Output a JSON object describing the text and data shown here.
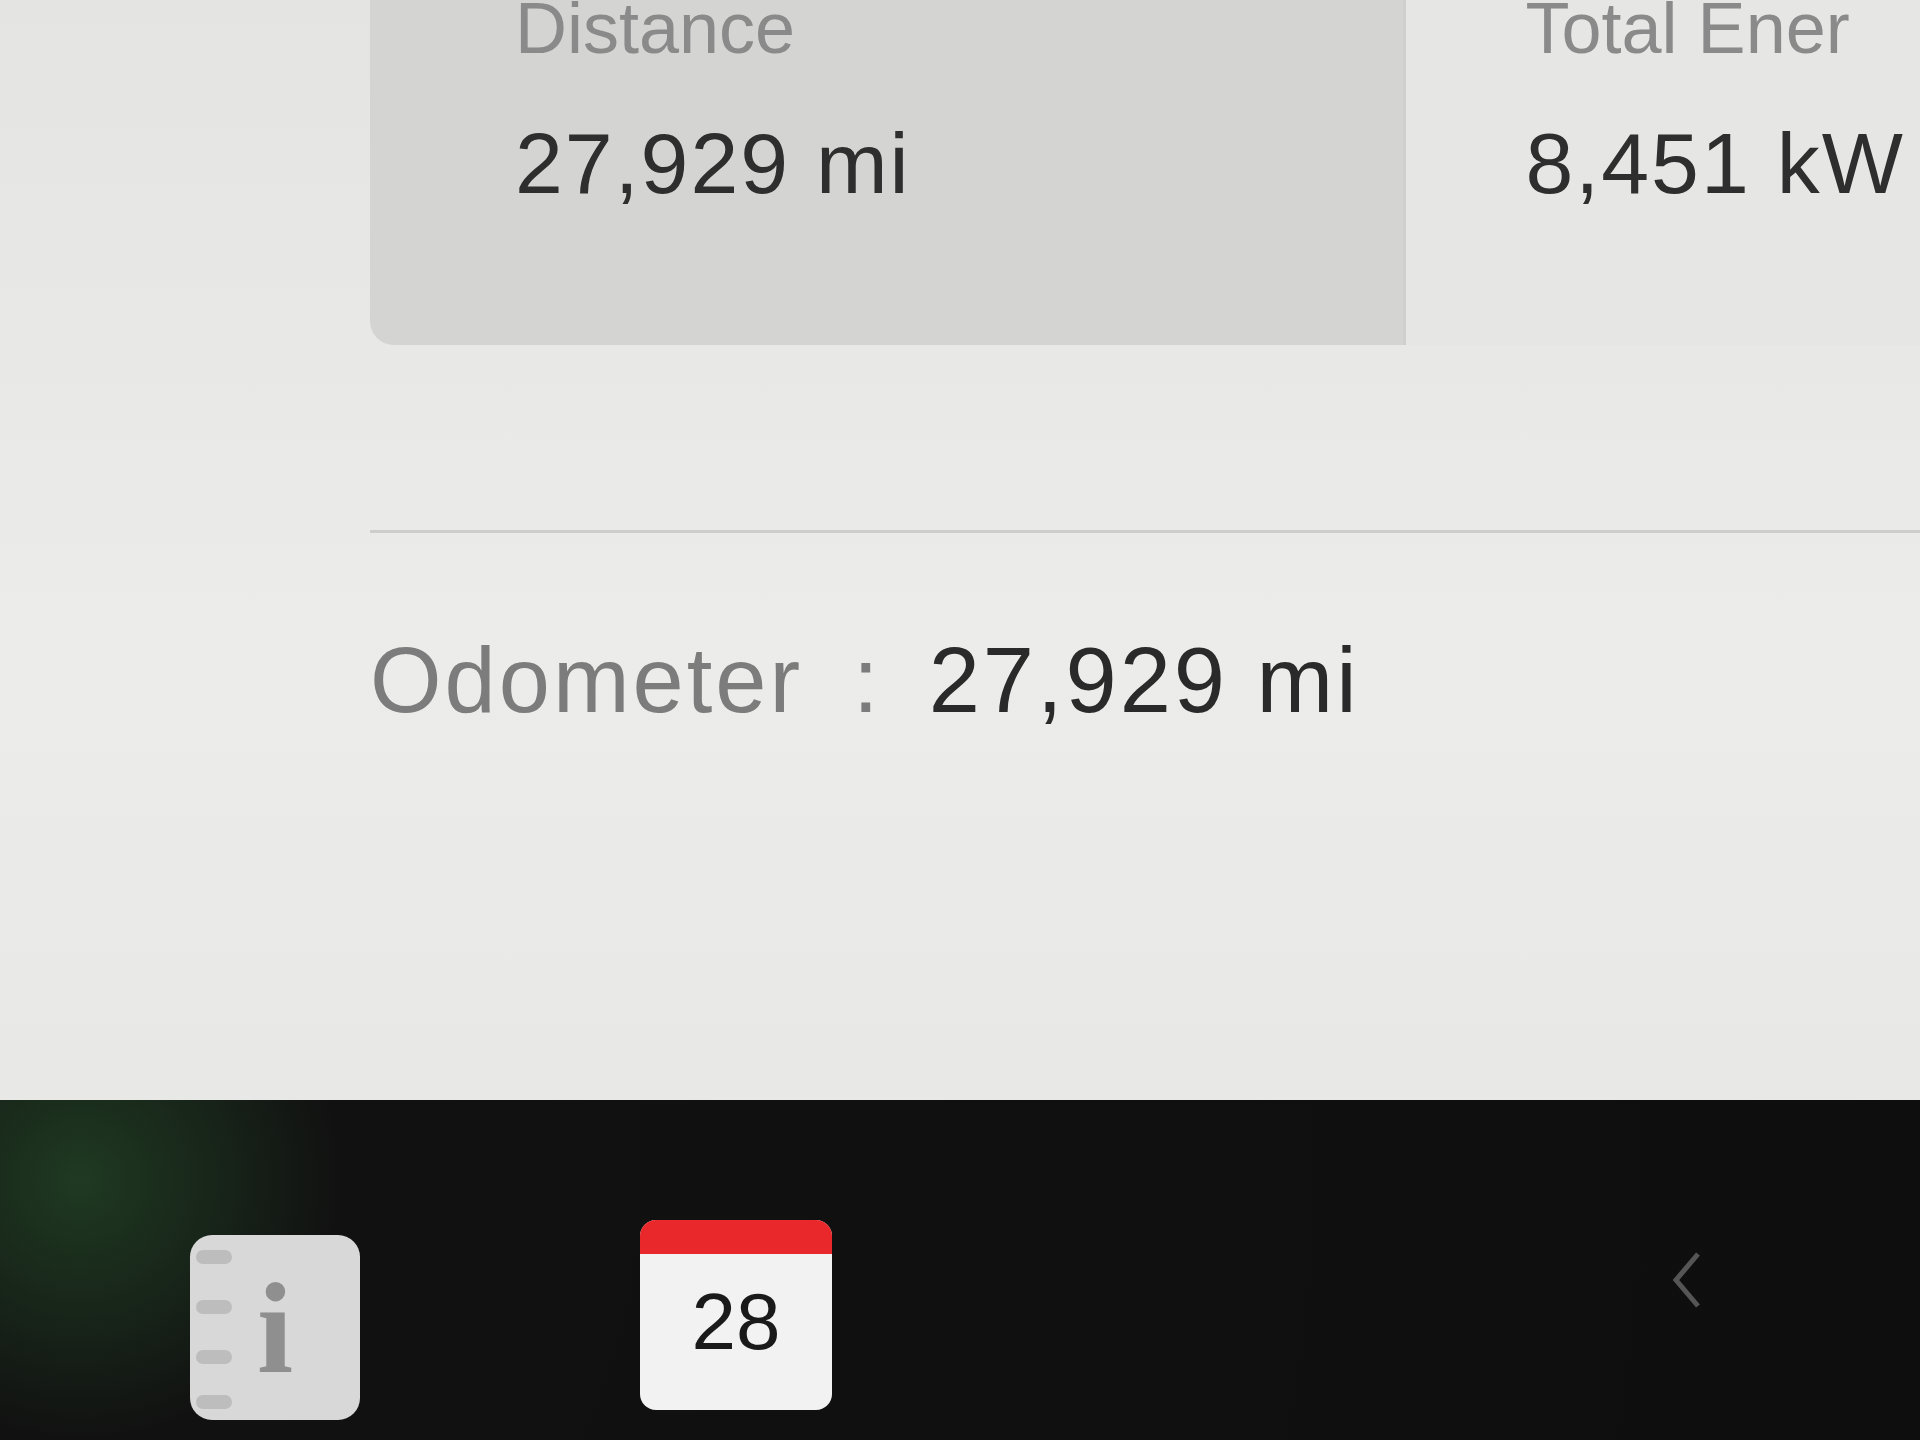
{
  "stats": [
    {
      "label": "Distance",
      "value": "27,929 mi"
    },
    {
      "label": "Total Ener",
      "value": "8,451 kW"
    }
  ],
  "odometer": {
    "label": "Odometer",
    "separator": ":",
    "value": "27,929 mi"
  },
  "dock": [
    {
      "kind": "manual",
      "label": "i"
    },
    {
      "kind": "calendar",
      "label": "28"
    },
    {
      "kind": "chevron"
    }
  ]
}
